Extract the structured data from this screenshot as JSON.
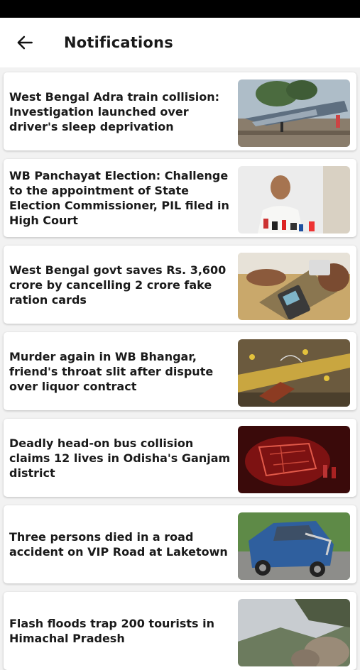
{
  "header": {
    "title": "Notifications",
    "back_icon": "arrow-left-icon"
  },
  "notifications": [
    {
      "title": "West Bengal Adra train collision: Investigation launched over driver's sleep deprivation",
      "image": "train-derailment-photo"
    },
    {
      "title": "WB Panchayat Election: Challenge to the appointment of State Election Commissioner, PIL filed in High Court",
      "image": "press-conference-photo"
    },
    {
      "title": "West Bengal govt saves Rs. 3,600 crore by cancelling 2 crore fake ration cards",
      "image": "biometric-ration-device-photo"
    },
    {
      "title": "Murder again in WB Bhangar, friend's throat slit after dispute over liquor contract",
      "image": "crime-scene-tape-photo"
    },
    {
      "title": "Deadly head-on bus collision claims 12 lives in Odisha's Ganjam district",
      "image": "bus-wreck-night-photo"
    },
    {
      "title": "Three persons died in a road accident on VIP Road at Laketown",
      "image": "crashed-car-photo"
    },
    {
      "title": "Flash floods trap 200 tourists in Himachal Pradesh",
      "image": "landslide-rocks-photo"
    }
  ]
}
